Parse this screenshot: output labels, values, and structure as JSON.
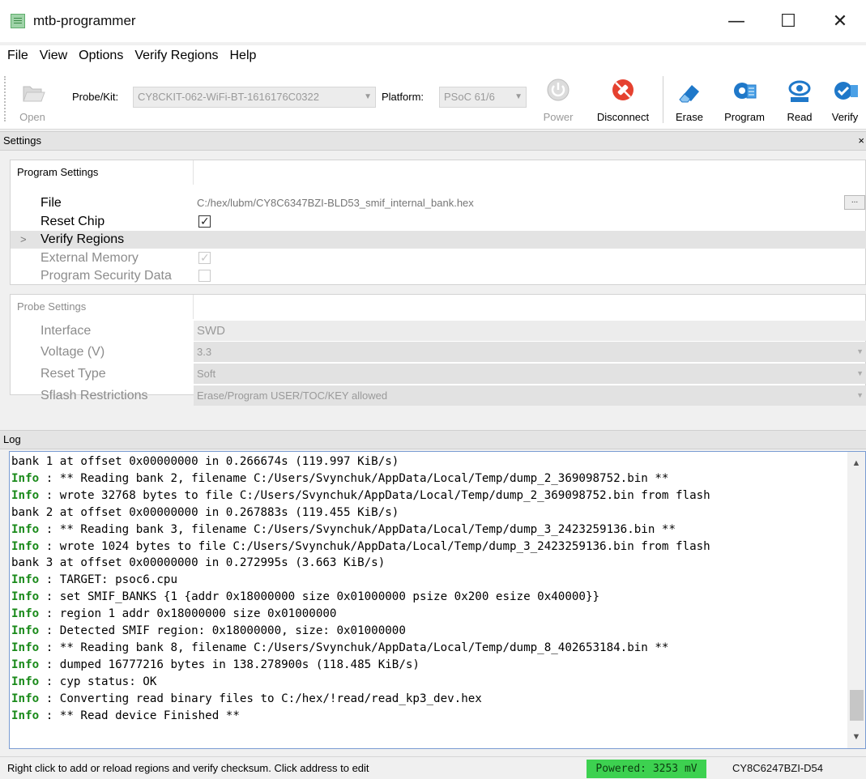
{
  "window": {
    "title": "mtb-programmer",
    "minimize": "—",
    "maximize": "☐",
    "close": "✕"
  },
  "menu": {
    "file": "File",
    "view": "View",
    "options": "Options",
    "verify_regions": "Verify Regions",
    "help": "Help"
  },
  "toolbar": {
    "open": "Open",
    "probe_label": "Probe/Kit:",
    "probe_value": "CY8CKIT-062-WiFi-BT-1616176C0322",
    "platform_label": "Platform:",
    "platform_value": "PSoC 61/6",
    "power": "Power",
    "disconnect": "Disconnect",
    "erase": "Erase",
    "program": "Program",
    "read": "Read",
    "verify": "Verify"
  },
  "settings": {
    "header": "Settings",
    "close": "×",
    "program_settings": {
      "title": "Program Settings",
      "file_label": "File",
      "file_value": "C:/hex/lubm/CY8C6347BZI-BLD53_smif_internal_bank.hex",
      "browse": "...",
      "reset_chip_label": "Reset Chip",
      "reset_chip_checked": true,
      "verify_regions_label": "Verify Regions",
      "expand_arrow": ">",
      "external_memory_label": "External Memory",
      "external_memory_checked": true,
      "program_security_label": "Program Security Data",
      "program_security_checked": false
    },
    "probe_settings": {
      "title": "Probe Settings",
      "interface_label": "Interface",
      "interface_value": "SWD",
      "voltage_label": "Voltage (V)",
      "voltage_value": "3.3",
      "reset_type_label": "Reset Type",
      "reset_type_value": "Soft",
      "sflash_label": "Sflash Restrictions",
      "sflash_value": "Erase/Program USER/TOC/KEY allowed"
    }
  },
  "log": {
    "header": "Log",
    "lines": [
      {
        "tag": "",
        "text": "bank 1 at offset 0x00000000 in 0.266674s (119.997 KiB/s)"
      },
      {
        "tag": "Info",
        "text": " : ** Reading bank 2, filename C:/Users/Svynchuk/AppData/Local/Temp/dump_2_369098752.bin **"
      },
      {
        "tag": "Info",
        "text": " : wrote 32768 bytes to file C:/Users/Svynchuk/AppData/Local/Temp/dump_2_369098752.bin from flash"
      },
      {
        "tag": "",
        "text": "bank 2 at offset 0x00000000 in 0.267883s (119.455 KiB/s)"
      },
      {
        "tag": "Info",
        "text": " : ** Reading bank 3, filename C:/Users/Svynchuk/AppData/Local/Temp/dump_3_2423259136.bin **"
      },
      {
        "tag": "Info",
        "text": " : wrote 1024 bytes to file C:/Users/Svynchuk/AppData/Local/Temp/dump_3_2423259136.bin from flash"
      },
      {
        "tag": "",
        "text": "bank 3 at offset 0x00000000 in 0.272995s (3.663 KiB/s)"
      },
      {
        "tag": "Info",
        "text": " : TARGET: psoc6.cpu"
      },
      {
        "tag": "Info",
        "text": " : set SMIF_BANKS {1 {addr 0x18000000 size 0x01000000 psize 0x200 esize 0x40000}}"
      },
      {
        "tag": "Info",
        "text": " : region 1 addr 0x18000000 size 0x01000000"
      },
      {
        "tag": "Info",
        "text": " : Detected SMIF region: 0x18000000, size: 0x01000000"
      },
      {
        "tag": "Info",
        "text": " : ** Reading bank 8, filename C:/Users/Svynchuk/AppData/Local/Temp/dump_8_402653184.bin **"
      },
      {
        "tag": "Info",
        "text": " : dumped 16777216 bytes in 138.278900s (118.485 KiB/s)"
      },
      {
        "tag": "Info",
        "text": " : cyp status: OK"
      },
      {
        "tag": "Info",
        "text": " : Converting read binary files to C:/hex/!read/read_kp3_dev.hex"
      },
      {
        "tag": "Info",
        "text": " : ** Read device Finished **"
      }
    ]
  },
  "status": {
    "message": "Right click to add or reload regions and verify checksum. Click address to edit",
    "power": "Powered: 3253 mV",
    "device": "CY8C6247BZI-D54"
  },
  "colors": {
    "info_tag": "#1a8a1a",
    "powered_bg": "#3dd150",
    "disconnect_icon": "#e5412f",
    "action_icon": "#1f78c9"
  }
}
